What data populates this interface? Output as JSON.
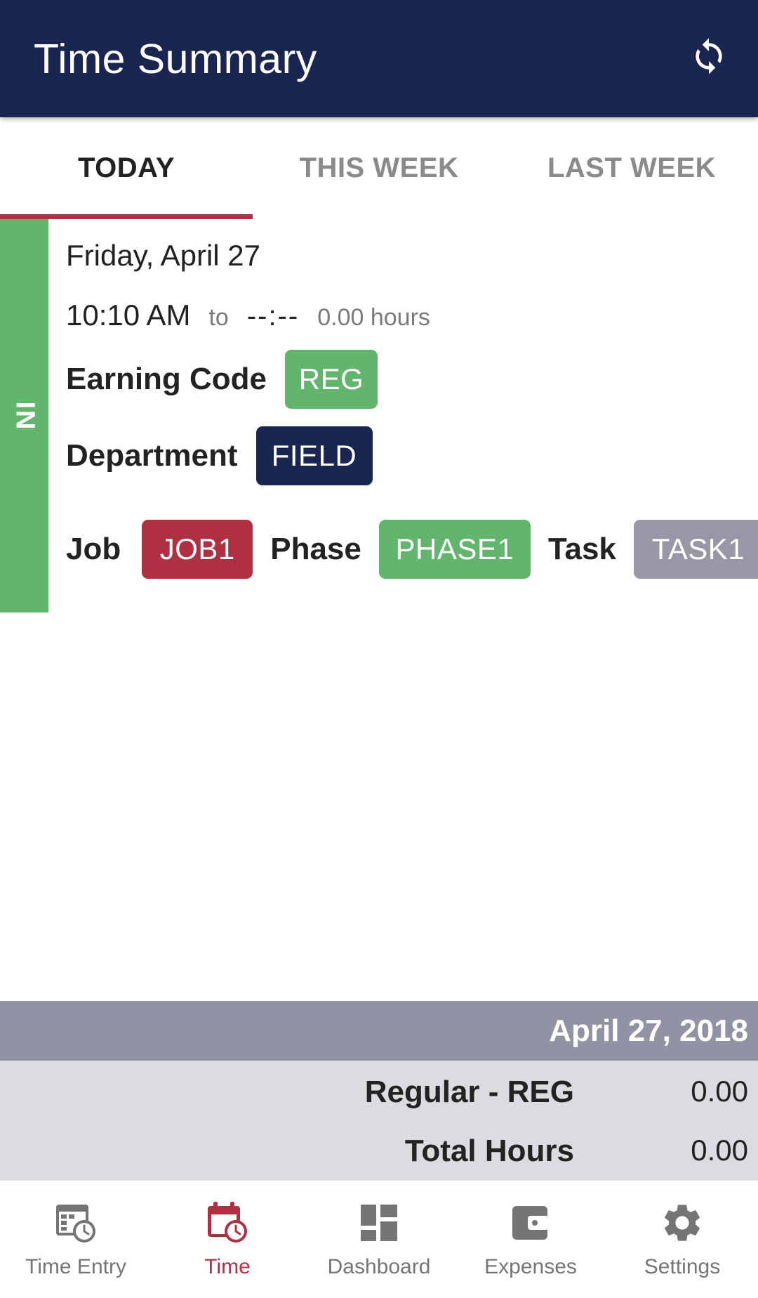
{
  "appbar": {
    "title": "Time Summary",
    "refresh_icon": "refresh-icon"
  },
  "tabs": [
    {
      "label": "TODAY",
      "active": true
    },
    {
      "label": "THIS WEEK",
      "active": false
    },
    {
      "label": "LAST WEEK",
      "active": false
    }
  ],
  "entry": {
    "status": "IN",
    "date": "Friday, April 27",
    "start_time": "10:10 AM",
    "to_label": "to",
    "end_time": "--:--",
    "hours": "0.00 hours",
    "earning_code_label": "Earning Code",
    "earning_code": "REG",
    "department_label": "Department",
    "department": "FIELD",
    "job_label": "Job",
    "job": "JOB1",
    "phase_label": "Phase",
    "phase": "PHASE1",
    "task_label": "Task",
    "task": "TASK1"
  },
  "summary": {
    "date": "April 27, 2018",
    "rows": [
      {
        "label": "Regular - REG",
        "value": "0.00"
      },
      {
        "label": "Total Hours",
        "value": "0.00"
      }
    ]
  },
  "bottom_nav": [
    {
      "label": "Time Entry",
      "icon": "time-entry-icon",
      "active": false
    },
    {
      "label": "Time",
      "icon": "calendar-clock-icon",
      "active": true
    },
    {
      "label": "Dashboard",
      "icon": "dashboard-icon",
      "active": false
    },
    {
      "label": "Expenses",
      "icon": "wallet-icon",
      "active": false
    },
    {
      "label": "Settings",
      "icon": "gear-icon",
      "active": false
    }
  ],
  "colors": {
    "primary": "#1b2650",
    "accent": "#b03043",
    "status_in": "#63b56d",
    "chip_gray": "#9797a6",
    "nav_inactive": "#757575"
  }
}
